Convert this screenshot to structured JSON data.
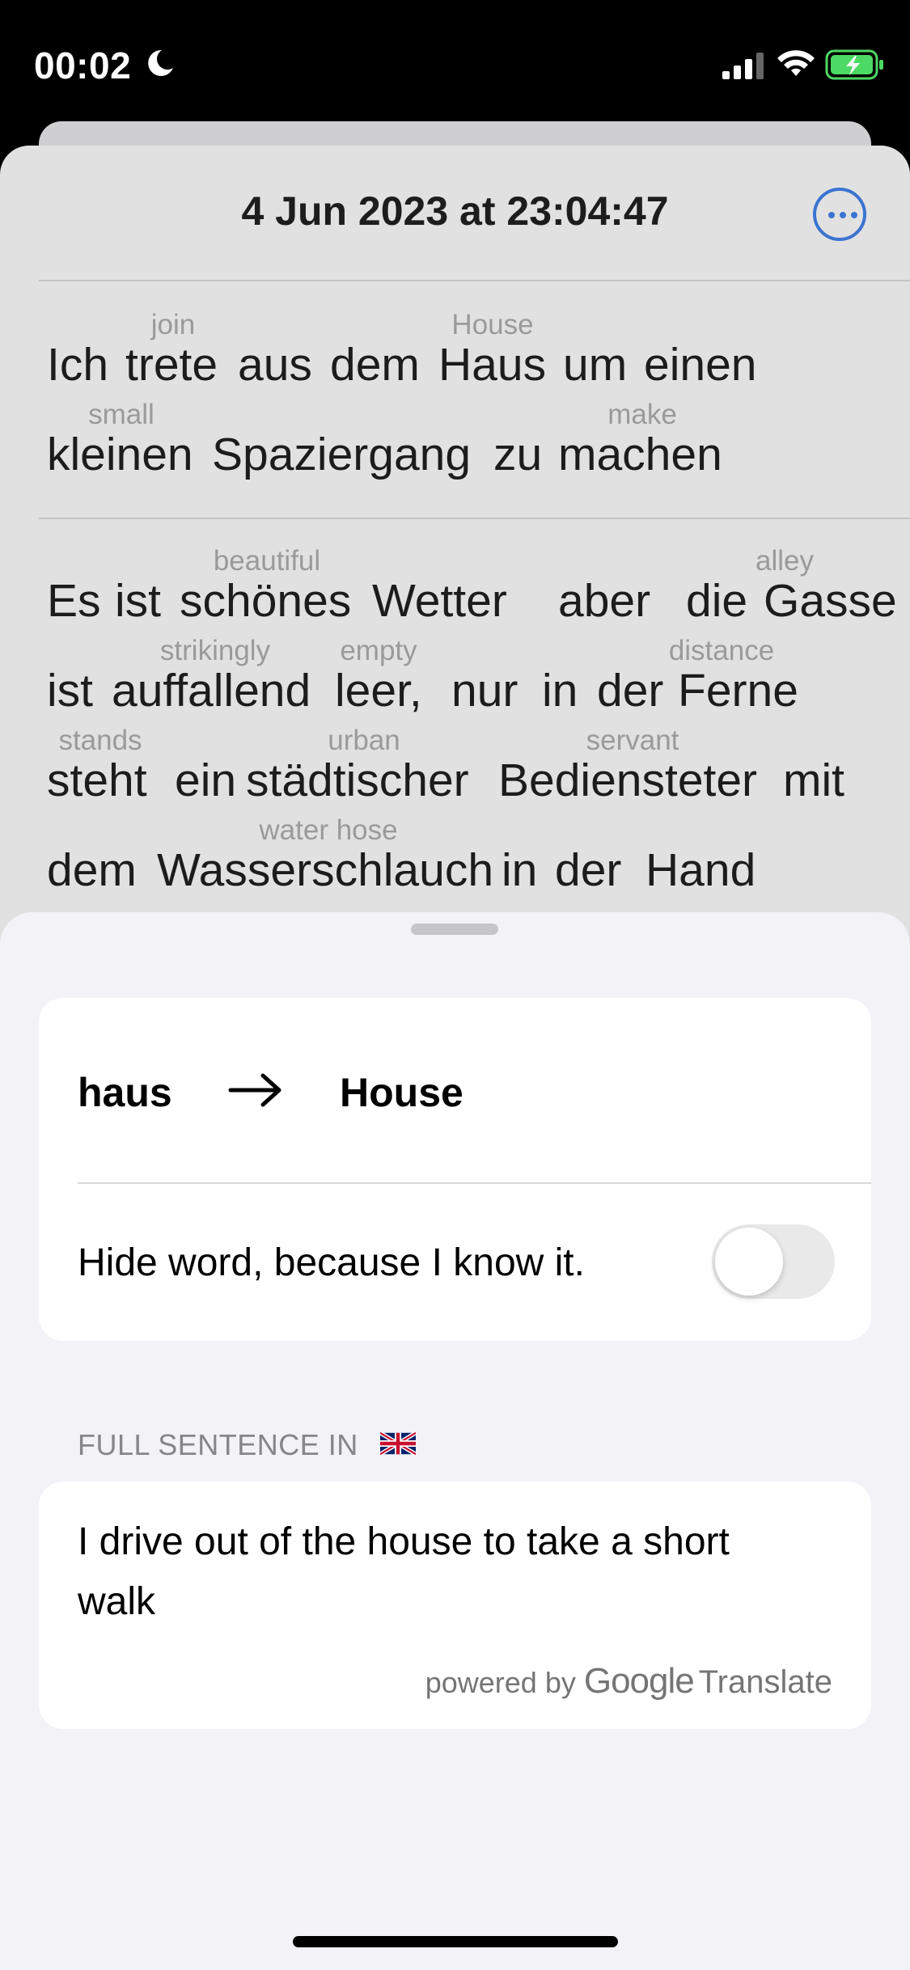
{
  "status_bar": {
    "time": "00:02"
  },
  "header": {
    "title": "4 Jun 2023 at 23:04:47"
  },
  "sentence1": {
    "lines": [
      {
        "words": [
          "Ich",
          "trete",
          "aus",
          "dem",
          "Haus",
          "um",
          "einen"
        ],
        "glosses": [
          {
            "word": 1,
            "text": "join"
          },
          {
            "word": 4,
            "text": "House"
          }
        ]
      },
      {
        "words": [
          "kleinen",
          "Spaziergang",
          "zu",
          "machen"
        ],
        "glosses": [
          {
            "word": 0,
            "text": "small"
          },
          {
            "word": 3,
            "text": "make"
          }
        ]
      }
    ]
  },
  "sentence2": {
    "lines": [
      {
        "words": [
          "Es",
          "ist",
          "schönes",
          "Wetter",
          "aber",
          "die",
          "Gasse"
        ],
        "glosses": [
          {
            "word": 2,
            "text": "beautiful"
          },
          {
            "word": 6,
            "text": "alley"
          }
        ]
      },
      {
        "words": [
          "ist",
          "auffallend",
          "leer,",
          "nur",
          "in",
          "der",
          "Ferne"
        ],
        "glosses": [
          {
            "word": 1,
            "text": "strikingly"
          },
          {
            "word": 2,
            "text": "empty"
          },
          {
            "word": 6,
            "text": "distance"
          }
        ]
      },
      {
        "words": [
          "steht",
          "ein",
          "städtischer",
          "Bediensteter",
          "mit"
        ],
        "glosses": [
          {
            "word": 0,
            "text": "stands"
          },
          {
            "word": 2,
            "text": "urban"
          },
          {
            "word": 3,
            "text": "servant"
          }
        ]
      },
      {
        "words": [
          "dem",
          "Wasserschlauch",
          "in",
          "der",
          "Hand"
        ],
        "glosses": [
          {
            "word": 1,
            "text": "water hose"
          }
        ]
      }
    ]
  },
  "word_card": {
    "source": "haus",
    "target": "House",
    "hide_label": "Hide word, because I know it.",
    "hide_toggle_on": false
  },
  "full_sentence": {
    "header": "FULL SENTENCE IN",
    "flag": "uk-flag-icon",
    "text": "I drive out of the house to take a short walk",
    "powered_by": "powered by",
    "google": "Google",
    "translate": "Translate"
  }
}
